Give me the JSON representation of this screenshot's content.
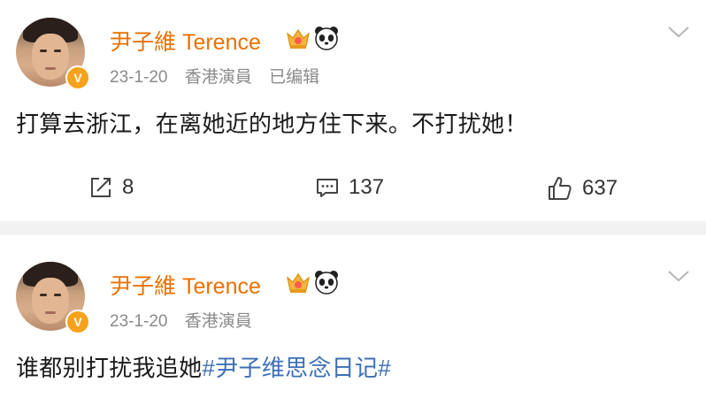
{
  "colors": {
    "name": "#eb7100",
    "meta": "#8a8a8a",
    "topic": "#3e6fb5",
    "badge": "#f7a21b",
    "divider": "#f2f2f2"
  },
  "posts": [
    {
      "author": "尹子維 Terence",
      "date": "23-1-20",
      "source": "香港演員",
      "edited": "已编辑",
      "text": "打算去浙江，在离她近的地方住下来。不打扰她！",
      "reposts": "8",
      "comments": "137",
      "likes": "637",
      "badge": "V"
    },
    {
      "author": "尹子維 Terence",
      "date": "23-1-20",
      "source": "香港演員",
      "text": "谁都别打扰我追她",
      "topic": "#尹子维思念日记#",
      "badge": "V"
    }
  ]
}
